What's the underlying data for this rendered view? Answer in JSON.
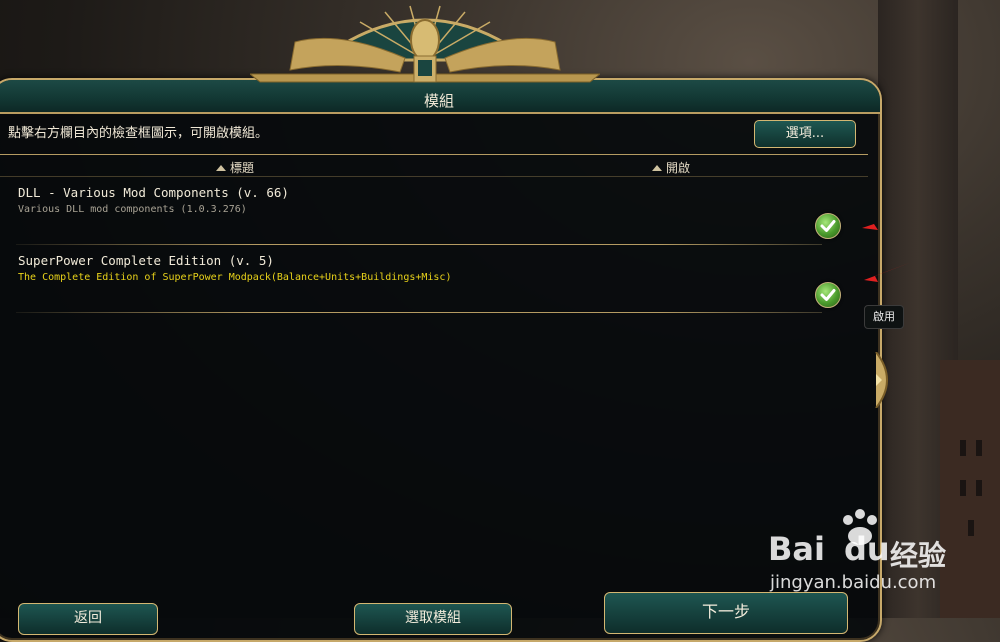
{
  "dialog": {
    "title": "模組",
    "instruction": "點擊右方欄目內的檢查框圖示，可開啟模組。",
    "options_button": "選項..."
  },
  "columns": {
    "title": "標題",
    "enabled": "開啟"
  },
  "mods": [
    {
      "name": "DLL - Various Mod Components (v. 66)",
      "description": "Various DLL mod components (1.0.3.276)",
      "desc_color": "#a9a395",
      "enabled": true
    },
    {
      "name": "SuperPower Complete Edition (v. 5)",
      "description": "The Complete Edition of SuperPower Modpack(Balance+Units+Buildings+Misc)",
      "desc_color": "#e8d21a",
      "enabled": true
    }
  ],
  "tooltip": "啟用",
  "bottom_buttons": {
    "back": "返回",
    "select_mods": "選取模組",
    "next": "下一步"
  },
  "watermark": {
    "brand": "Bai",
    "brand2": "du",
    "cn": "经验",
    "url": "jingyan.baidu.com"
  },
  "colors": {
    "accent_gold": "#c7a96a",
    "header_teal": "#1d4a45",
    "annotation_red": "#e02020"
  }
}
